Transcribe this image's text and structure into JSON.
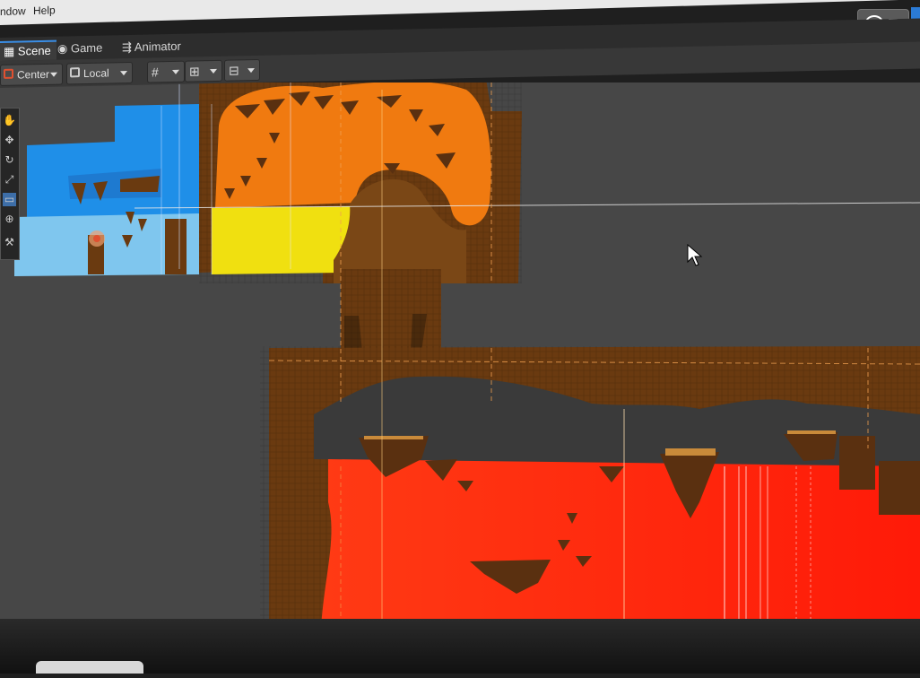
{
  "menubar": {
    "items": [
      "ndow",
      "Help"
    ]
  },
  "tabs": [
    {
      "label": "Scene",
      "icon": "grid-icon",
      "active": true
    },
    {
      "label": "Game",
      "icon": "gamepad-icon",
      "active": false
    },
    {
      "label": "Animator",
      "icon": "animator-icon",
      "active": false
    }
  ],
  "toolbar": {
    "pivot_label": "Center",
    "space_label": "Local",
    "grid_snap_icon": "grid-snap-icon",
    "increment_snap_icon": "increment-snap-icon",
    "gizmo_icon": "gizmo-icon"
  },
  "left_tools": [
    "hand-icon",
    "move-icon",
    "rotate-icon",
    "scale-icon",
    "rect-icon",
    "transform-icon",
    "custom-tool-icon"
  ],
  "colors": {
    "sky_blue": "#1f8fe8",
    "light_blue": "#7fc6ee",
    "orange": "#f07a10",
    "yellow": "#f0e010",
    "dirt": "#6a3a10",
    "dark_cave": "#3a3a3a",
    "lava_red": "#ff2a10",
    "scene_bg": "#474747",
    "accent": "#3a8ee6"
  }
}
